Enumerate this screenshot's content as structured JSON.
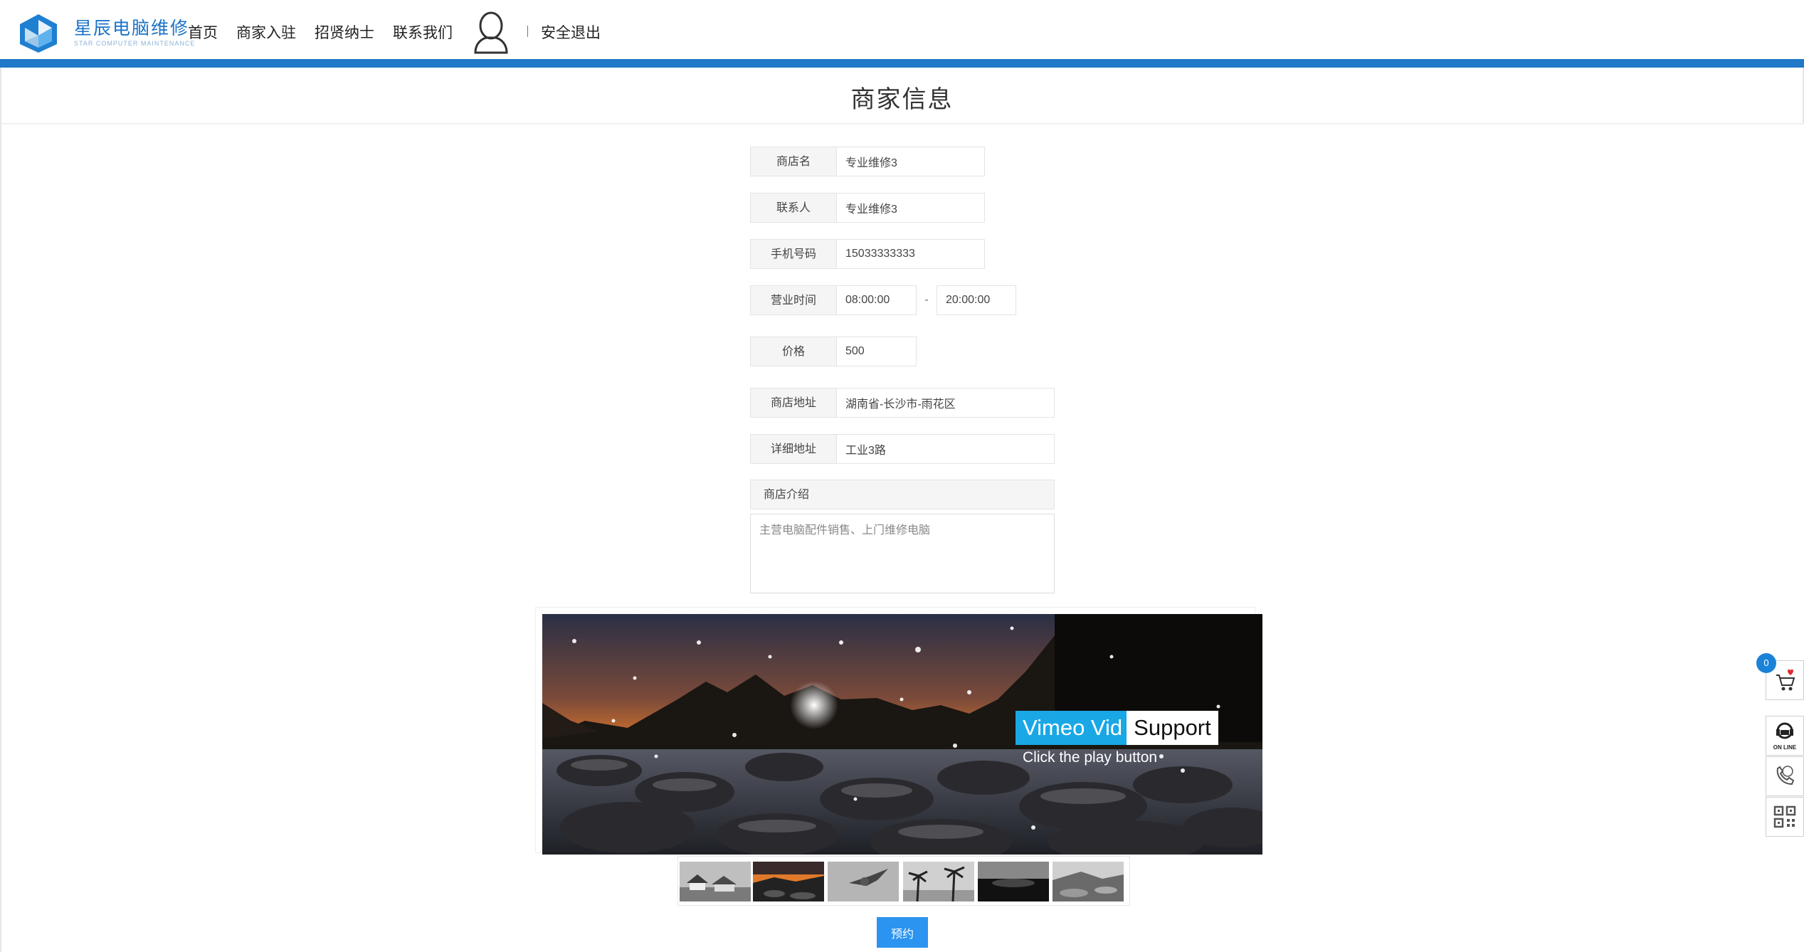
{
  "header": {
    "logo_text": "星辰电脑维修",
    "logo_subtext": "STAR COMPUTER MAINTENANCE",
    "nav": [
      "首页",
      "商家入驻",
      "招贤纳士",
      "联系我们"
    ],
    "logout": "安全退出",
    "accent_color": "#1f78c8"
  },
  "page_title": "商家信息",
  "form": {
    "shop_name": {
      "label": "商店名",
      "value": "专业维修3"
    },
    "contact": {
      "label": "联系人",
      "value": "专业维修3"
    },
    "phone": {
      "label": "手机号码",
      "value": "15033333333"
    },
    "hours": {
      "label": "营业时间",
      "start": "08:00:00",
      "separator": "-",
      "end": "20:00:00"
    },
    "price": {
      "label": "价格",
      "value": "500"
    },
    "address": {
      "label": "商店地址",
      "value": "湖南省-长沙市-雨花区"
    },
    "detail_address": {
      "label": "详细地址",
      "value": "工业3路"
    },
    "intro": {
      "label": "商店介绍",
      "value": "主营电脑配件销售、上门维修电脑"
    }
  },
  "slider": {
    "caption_highlight": "Vimeo Vid",
    "caption_rest": "Support",
    "caption_sub": "Click the play button",
    "thumbnail_count": 6
  },
  "book_button": "预约",
  "sidebar": {
    "cart_count": "0",
    "items": [
      "cart-icon",
      "online-service-icon",
      "phone-icon",
      "qr-code-icon"
    ],
    "online_text": "ON LINE"
  }
}
